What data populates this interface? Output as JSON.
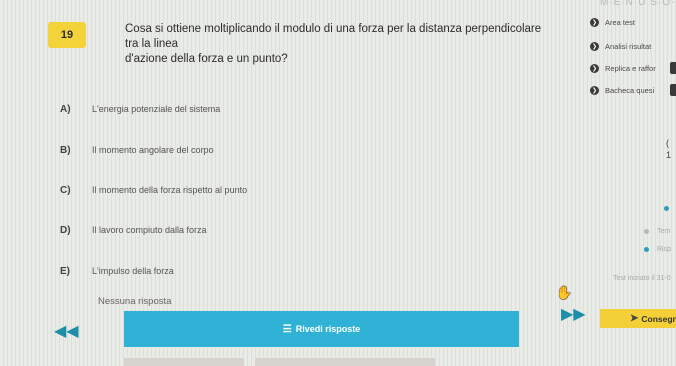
{
  "brand": {
    "text": "M·E·N·U  S·O·D·O·E"
  },
  "question": {
    "number": "19",
    "text_line1": "Cosa si ottiene moltiplicando il modulo di una forza per la distanza perpendicolare tra la linea",
    "text_line2": "d'azione della forza e un punto?"
  },
  "answers": [
    {
      "letter": "A)",
      "text": "L'energia potenziale del sistema"
    },
    {
      "letter": "B)",
      "text": "Il momento angolare del corpo"
    },
    {
      "letter": "C)",
      "text": "Il momento della forza rispetto al punto"
    },
    {
      "letter": "D)",
      "text": "Il lavoro compiuto dalla forza"
    },
    {
      "letter": "E)",
      "text": "L'impulso della forza"
    }
  ],
  "no_answer": "Nessuna risposta",
  "sidebar": {
    "items": [
      {
        "label": "Area test"
      },
      {
        "label": "Analisi risultat"
      },
      {
        "label": "Replica e raffor"
      },
      {
        "label": "Bacheca quesi"
      }
    ],
    "edge_marks": [
      "(",
      "1"
    ]
  },
  "legend": [
    {
      "label": "Tem",
      "color": "#b5b8b3"
    },
    {
      "label": "Risp",
      "color": "#2c9fb8"
    }
  ],
  "test_started": "Test iniziato il 31-0",
  "buttons": {
    "review": "Rivedi risposte",
    "submit": "Consegna"
  },
  "colors": {
    "accent_blue": "#30b2d6",
    "accent_yellow": "#f3cf38"
  }
}
